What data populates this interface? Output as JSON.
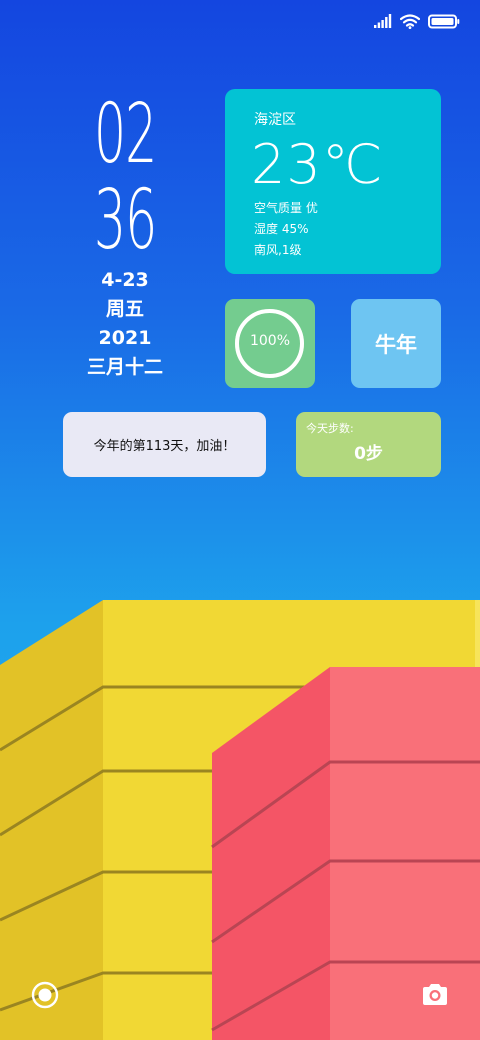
{
  "clock": {
    "hour": "02",
    "minute": "36",
    "date": "4-23",
    "weekday": "周五",
    "year": "2021",
    "lunar_date": "三月十二"
  },
  "weather": {
    "district": "海淀区",
    "temperature": "23℃",
    "air_quality": "空气质量 优",
    "humidity": "湿度 45%",
    "wind": "南风,1级"
  },
  "battery": {
    "level_text": "100%",
    "level": 1.0
  },
  "zodiac_year": {
    "label": "牛年"
  },
  "day_count": {
    "text": "今年的第113天，加油！"
  },
  "steps": {
    "label": "今天步数:",
    "value": "0步"
  },
  "colors": {
    "background_top": "#1446e0",
    "background_bottom": "#22b5ee",
    "weather_card": "#03c3d4",
    "battery_card": "#74cc8f",
    "zodiac_card": "#6ec5f2",
    "steps_card": "#b2d87e",
    "yellow_block": "#f1d834",
    "red_block": "#f97079"
  },
  "icons": {
    "status": [
      "signal-icon",
      "wifi-icon",
      "battery-icon"
    ],
    "bottom_left": "record-icon",
    "bottom_right": "camera-icon"
  }
}
